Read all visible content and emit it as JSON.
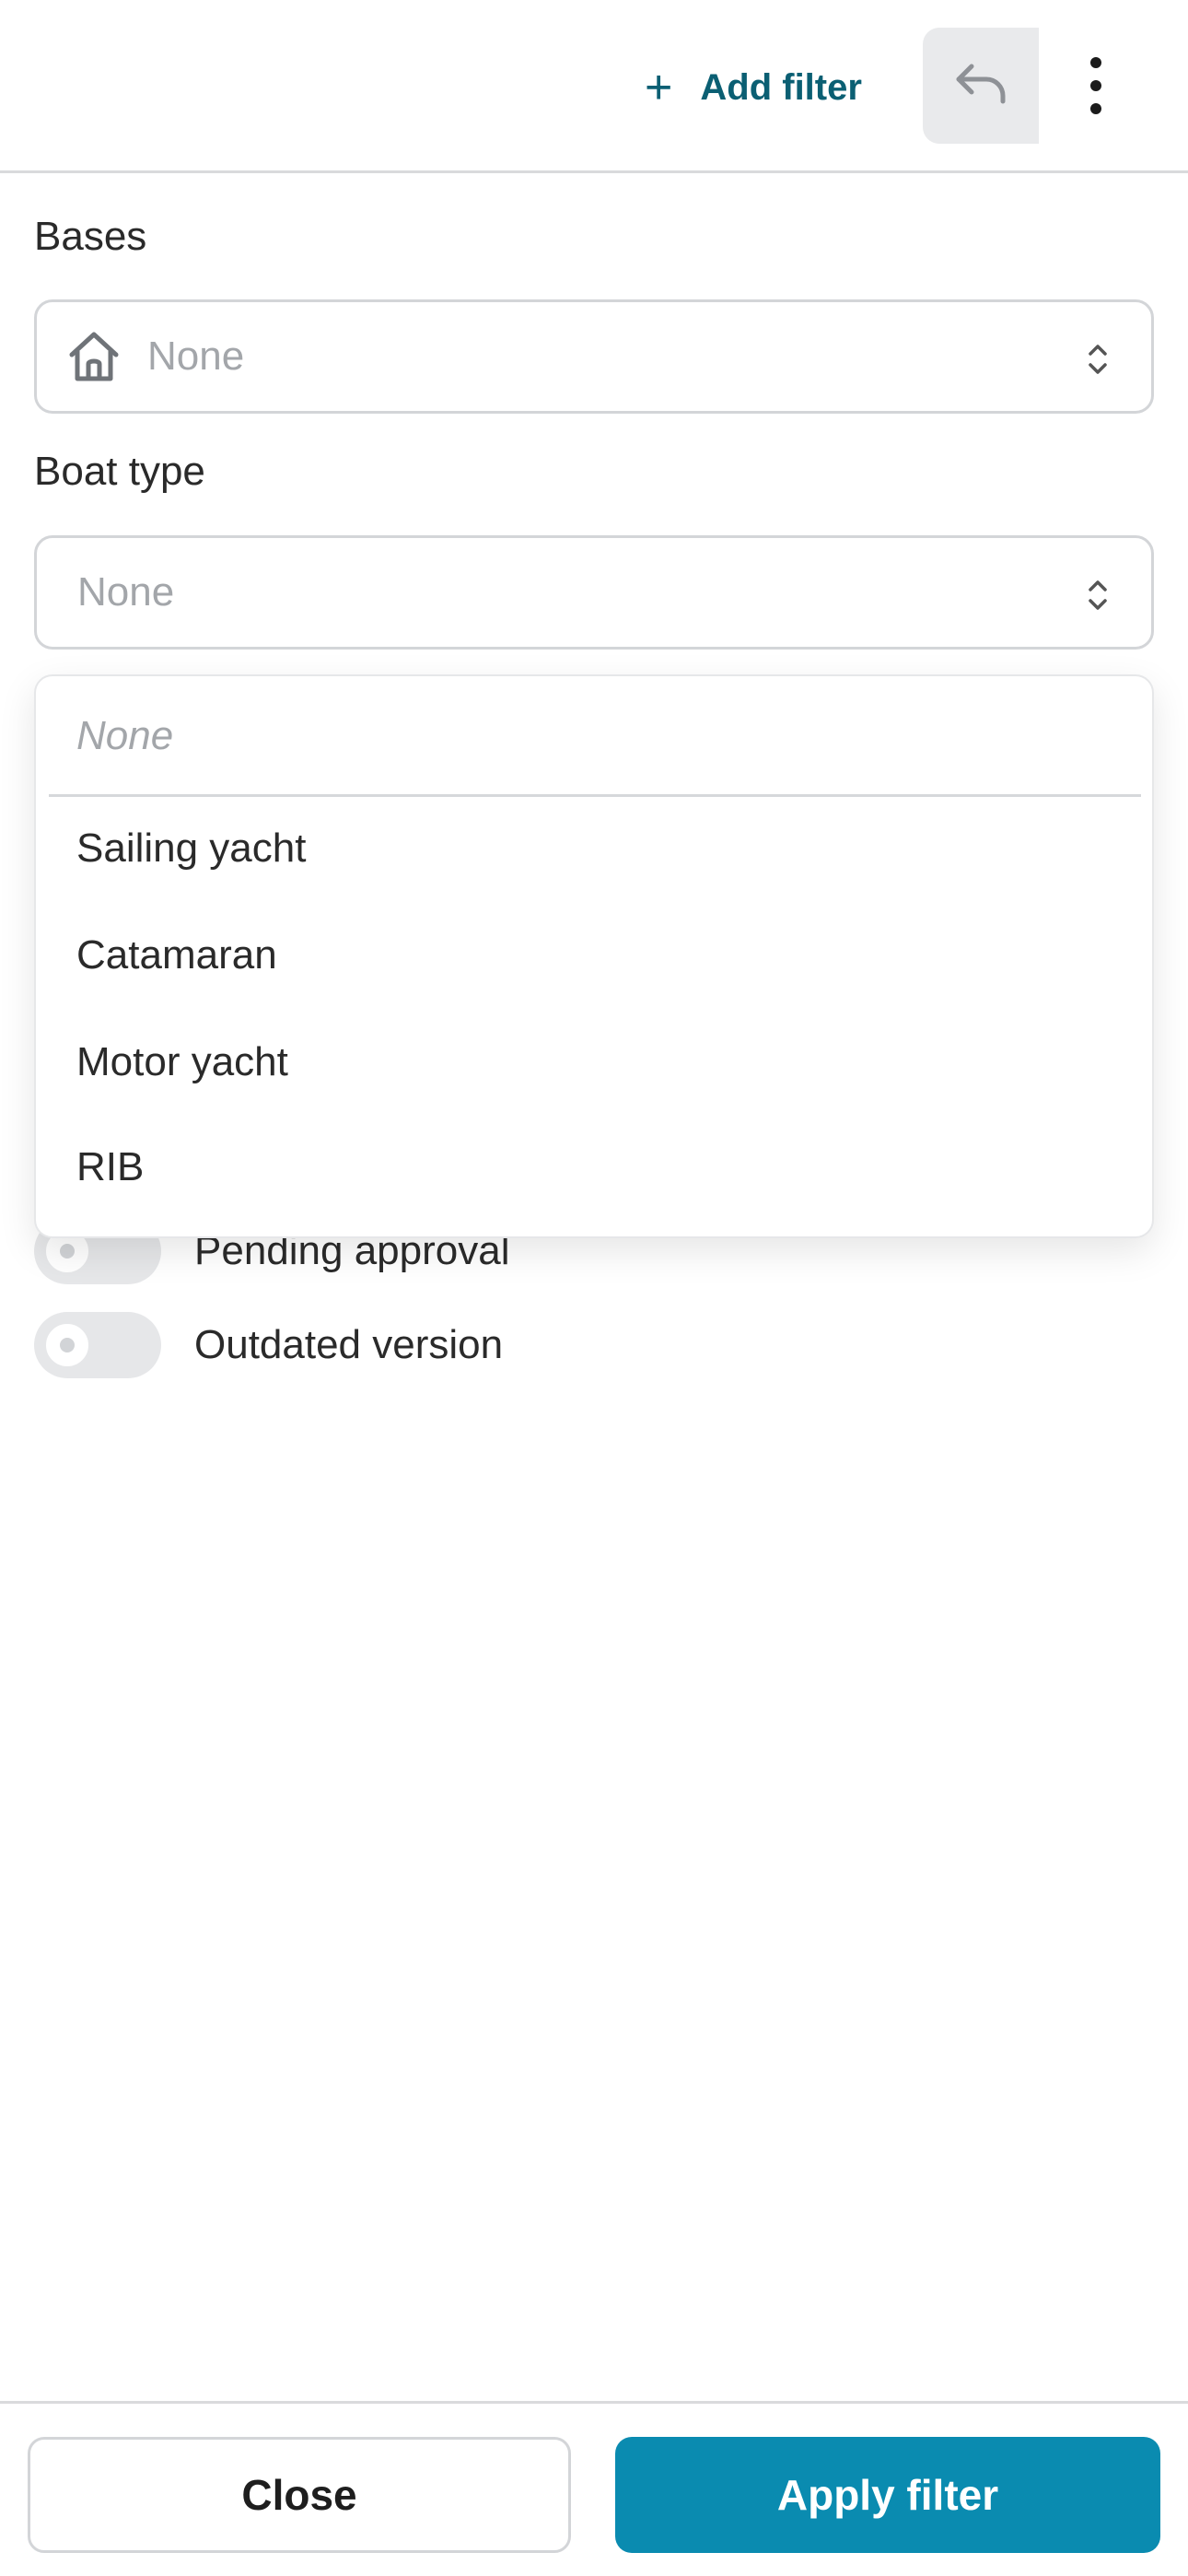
{
  "header": {
    "add_filter_label": "Add filter",
    "add_filter_icon": "plus-icon",
    "undo_icon": "undo-icon",
    "more_icon": "more-vertical-icon"
  },
  "bases": {
    "label": "Bases",
    "icon": "home-icon",
    "value": "None"
  },
  "boat_type": {
    "label": "Boat type",
    "value": "None"
  },
  "dropdown": {
    "none_option": "None",
    "options": [
      "Sailing yacht",
      "Catamaran",
      "Motor yacht",
      "RIB"
    ]
  },
  "toggles": [
    {
      "label": "Pending approval",
      "on": false
    },
    {
      "label": "Outdated version",
      "on": false
    }
  ],
  "footer": {
    "close_label": "Close",
    "apply_label": "Apply filter"
  },
  "colors": {
    "accent": "#0a8bb0",
    "link": "#0b5f73",
    "placeholder": "#a3a6aa",
    "border": "#d3d5d8"
  }
}
